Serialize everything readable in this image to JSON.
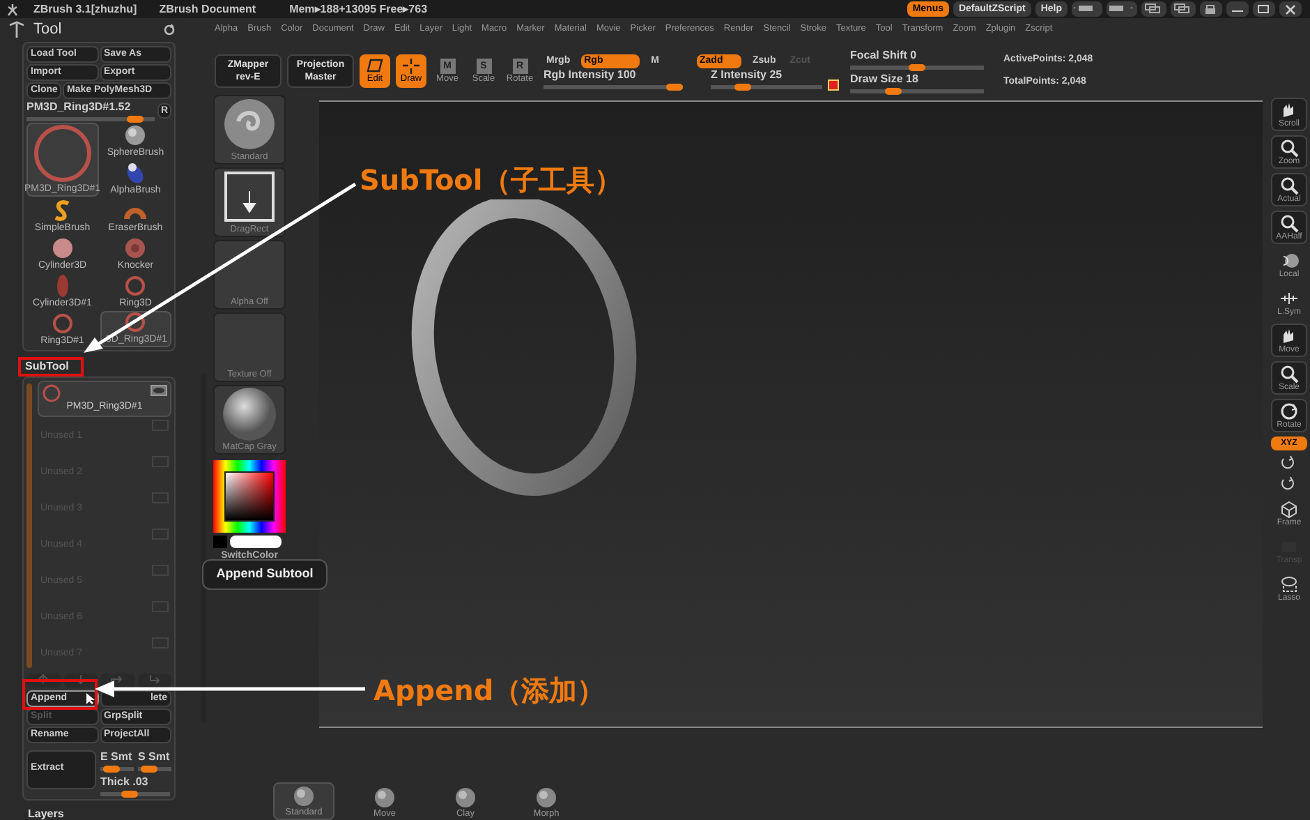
{
  "title_bar": {
    "app": "ZBrush 3.1[zhuzhu]",
    "document": "ZBrush Document",
    "memory": "Mem▸188+13095 Free▸763",
    "buttons": [
      {
        "label": "Menus",
        "selected": true
      },
      {
        "label": "DefaultZScript",
        "selected": false
      },
      {
        "label": "Help",
        "selected": false
      }
    ]
  },
  "menu_bar": [
    "Alpha",
    "Brush",
    "Color",
    "Document",
    "Draw",
    "Edit",
    "Layer",
    "Light",
    "Macro",
    "Marker",
    "Material",
    "Movie",
    "Picker",
    "Preferences",
    "Render",
    "Stencil",
    "Stroke",
    "Texture",
    "Tool",
    "Transform",
    "Zoom",
    "Zplugin",
    "Zscript"
  ],
  "tool_palette": {
    "title": "Tool",
    "buttons": [
      [
        "Load Tool",
        "Save As"
      ],
      [
        "Import",
        "Export"
      ],
      [
        "Clone",
        "Make PolyMesh3D"
      ]
    ],
    "slider": {
      "label": "PM3D_Ring3D#1.52",
      "level": 0.9
    },
    "r_button": "R",
    "tools": [
      {
        "label": "SphereBrush",
        "kind": "sphere",
        "selected": false
      },
      {
        "label": "PM3D_Ring3D#1",
        "kind": "ring_large",
        "selected": true
      },
      {
        "label": "AlphaBrush",
        "kind": "alpha",
        "selected": false
      },
      {
        "label": "SimpleBrush",
        "kind": "simple",
        "selected": false
      },
      {
        "label": "EraserBrush",
        "kind": "eraser",
        "selected": false
      },
      {
        "label": "Cylinder3D",
        "kind": "disc",
        "selected": false
      },
      {
        "label": "Knocker",
        "kind": "knocker",
        "selected": false
      },
      {
        "label": "Cylinder3D#1",
        "kind": "ellipse",
        "selected": false
      },
      {
        "label": "Ring3D",
        "kind": "ring",
        "selected": false
      },
      {
        "label": "Ring3D#1",
        "kind": "ring",
        "selected": false
      },
      {
        "label": "3D_Ring3D#1",
        "kind": "ring",
        "selected": true
      }
    ]
  },
  "subtool": {
    "title": "SubTool",
    "items": [
      {
        "label": "PM3D_Ring3D#1",
        "used": true
      },
      {
        "label": "Unused 1",
        "used": false
      },
      {
        "label": "Unused 2",
        "used": false
      },
      {
        "label": "Unused 3",
        "used": false
      },
      {
        "label": "Unused 4",
        "used": false
      },
      {
        "label": "Unused 5",
        "used": false
      },
      {
        "label": "Unused 6",
        "used": false
      },
      {
        "label": "Unused 7",
        "used": false
      }
    ],
    "buttons": [
      {
        "label": "Append",
        "disabled": false,
        "highlighted": true
      },
      {
        "label": "lete",
        "disabled": false,
        "highlighted": false
      },
      {
        "label": "Split",
        "disabled": true,
        "highlighted": false
      },
      {
        "label": "GrpSplit",
        "disabled": false,
        "highlighted": false
      },
      {
        "label": "Rename",
        "disabled": false,
        "highlighted": false
      },
      {
        "label": "ProjectAll",
        "disabled": false,
        "highlighted": false
      }
    ],
    "extract": "Extract",
    "sliders": [
      {
        "label": "E Smt",
        "level": 0.2
      },
      {
        "label": "S Smt",
        "level": 0.2
      },
      {
        "label": "Thick .03",
        "level": 0.4
      }
    ]
  },
  "layers_title": "Layers",
  "toolbar": {
    "zmapper": [
      "ZMapper",
      "rev-E"
    ],
    "projection": [
      "Projection",
      "Master"
    ],
    "modes": [
      {
        "label": "Edit",
        "on": true
      },
      {
        "label": "Draw",
        "on": true
      },
      {
        "label": "Move",
        "key": "M",
        "on": false
      },
      {
        "label": "Scale",
        "key": "S",
        "on": false
      },
      {
        "label": "Rotate",
        "key": "R",
        "on": false
      }
    ],
    "color_modes": [
      {
        "label": "Mrgb",
        "on": false
      },
      {
        "label": "Rgb",
        "on": true
      },
      {
        "label": "M",
        "on": false
      }
    ],
    "rgb_intensity": {
      "label": "Rgb Intensity 100",
      "level": 1
    },
    "z_modes": [
      {
        "label": "Zadd",
        "on": true,
        "disabled": false
      },
      {
        "label": "Zsub",
        "on": false,
        "disabled": false
      },
      {
        "label": "Zcut",
        "on": false,
        "disabled": true
      }
    ],
    "z_intensity": {
      "label": "Z Intensity 25",
      "level": 0.25
    },
    "focal_shift": {
      "label": "Focal Shift 0",
      "level": 0.5
    },
    "draw_size": {
      "label": "Draw Size 18",
      "level": 0.3
    },
    "active_points": "ActivePoints: 2,048",
    "total_points": "TotalPoints: 2,048"
  },
  "left_shelf": {
    "items": [
      "Standard",
      "DragRect",
      "Alpha Off",
      "Texture Off",
      "MatCap Gray"
    ],
    "color_label": "SwitchColor"
  },
  "tooltip": "Append Subtool",
  "right_shelf": [
    {
      "label": "Scroll",
      "kind": "boxed",
      "on": false,
      "disabled": false
    },
    {
      "label": "Zoom",
      "kind": "boxed",
      "on": false,
      "disabled": false
    },
    {
      "label": "Actual",
      "kind": "boxed",
      "on": false,
      "disabled": false
    },
    {
      "label": "AAHalf",
      "kind": "boxed",
      "on": false,
      "disabled": false
    },
    {
      "label": "Local",
      "kind": "plain",
      "on": false,
      "disabled": false
    },
    {
      "label": "L.Sym",
      "kind": "plain",
      "on": false,
      "disabled": false
    },
    {
      "label": "Move",
      "kind": "boxed",
      "on": false,
      "disabled": false
    },
    {
      "label": "Scale",
      "kind": "boxed",
      "on": false,
      "disabled": false
    },
    {
      "label": "Rotate",
      "kind": "boxed",
      "on": false,
      "disabled": false
    },
    {
      "label": "XYZ",
      "kind": "toggle",
      "on": true,
      "disabled": false
    },
    {
      "kind": "mini",
      "on": false,
      "disabled": false
    },
    {
      "kind": "mini",
      "on": false,
      "disabled": false
    },
    {
      "label": "Frame",
      "kind": "plain",
      "on": false,
      "disabled": false
    },
    {
      "label": "Transp",
      "kind": "plain",
      "on": false,
      "disabled": true
    },
    {
      "label": "Lasso",
      "kind": "plain",
      "on": false,
      "disabled": false
    }
  ],
  "bottom_shelf": [
    {
      "label": "Standard",
      "selected": true
    },
    {
      "label": "Move",
      "selected": false
    },
    {
      "label": "Clay",
      "selected": false
    },
    {
      "label": "Morph",
      "selected": false
    }
  ],
  "annotations": [
    {
      "label": "SubTool（子工具）"
    },
    {
      "label": "Append（添加）"
    }
  ]
}
